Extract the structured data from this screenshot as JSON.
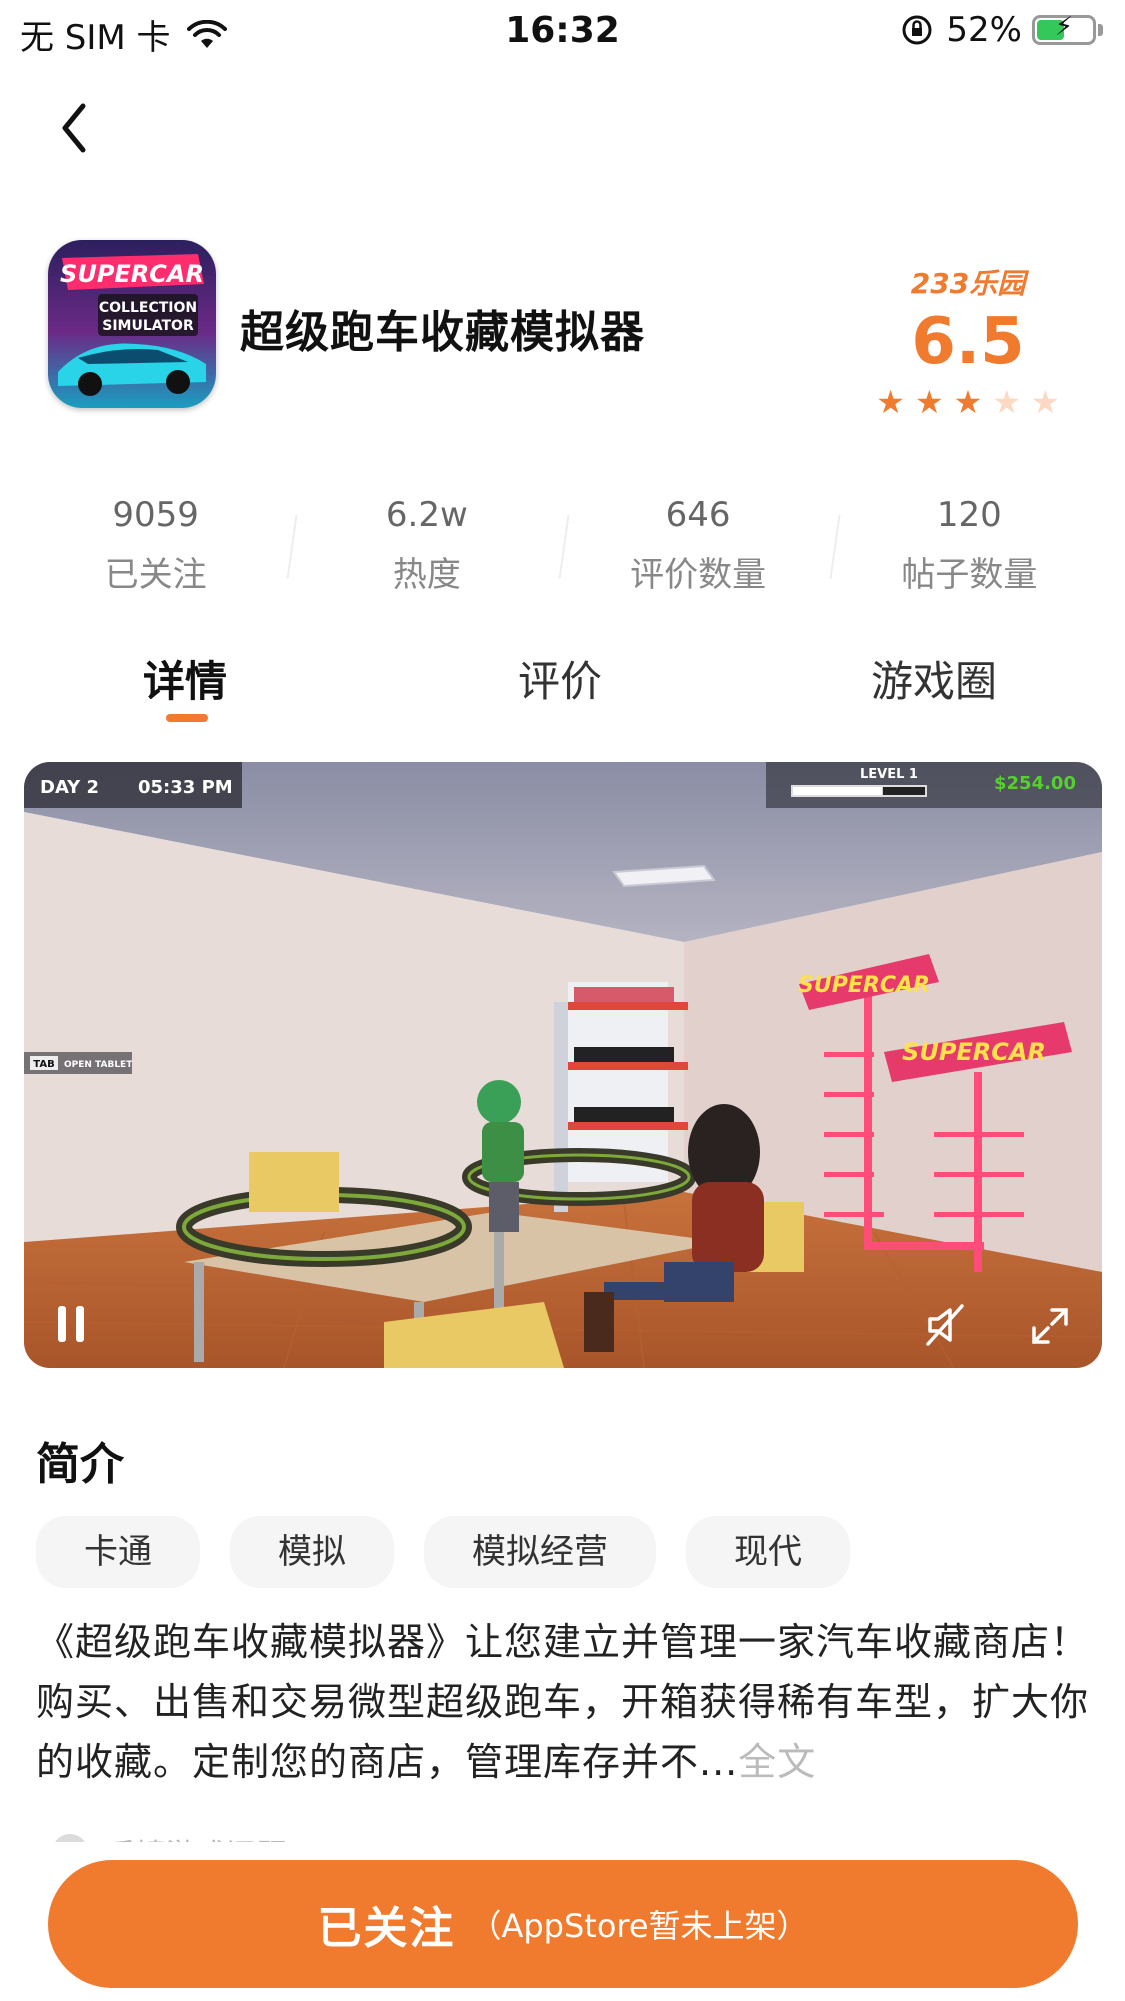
{
  "status_bar": {
    "carrier": "无 SIM 卡",
    "time": "16:32",
    "battery": "52%",
    "battery_level": 0.52,
    "icons": [
      "wifi-icon",
      "orientation-lock-icon",
      "battery-charging-icon"
    ]
  },
  "nav": {
    "back_icon": "chevron-left-icon"
  },
  "app": {
    "title": "超级跑车收藏模拟器",
    "icon_text": [
      "SUPERCAR",
      "COLLECTION",
      "SIMULATOR"
    ],
    "rating_brand": "233",
    "rating_brand_cn": "乐园",
    "rating_score": "6.5",
    "stars_filled": 3,
    "stars_total": 5
  },
  "stats": [
    {
      "value": "9059",
      "label": "已关注"
    },
    {
      "value": "6.2w",
      "label": "热度"
    },
    {
      "value": "646",
      "label": "评价数量"
    },
    {
      "value": "120",
      "label": "帖子数量"
    }
  ],
  "tabs": [
    {
      "label": "详情",
      "active": true
    },
    {
      "label": "评价",
      "active": false
    },
    {
      "label": "游戏圈",
      "active": false
    }
  ],
  "video": {
    "hud_day": "DAY 2",
    "hud_time": "05:33 PM",
    "hud_level": "LEVEL 1",
    "hud_money": "$254.00",
    "hud_tab_key": "TAB",
    "hud_tab_text": "OPEN TABLET",
    "sign_text": "SUPERCAR",
    "level_progress": 0.68
  },
  "intro": {
    "title": "简介",
    "tags": [
      "卡通",
      "模拟",
      "模拟经营",
      "现代"
    ],
    "description": "《超级跑车收藏模拟器》让您建立并管理一家汽车收藏商店！购买、出售和交易微型超级跑车，开箱获得稀有车型，扩大你的收藏。定制您的商店，管理库存并不...",
    "more": "全文",
    "feedback": "反馈游戏问题"
  },
  "bottom": {
    "follow_label": "已关注",
    "follow_note": "（AppStore暂未上架）"
  },
  "colors": {
    "accent": "#f07a2e",
    "star_empty": "#fbd9c2"
  }
}
